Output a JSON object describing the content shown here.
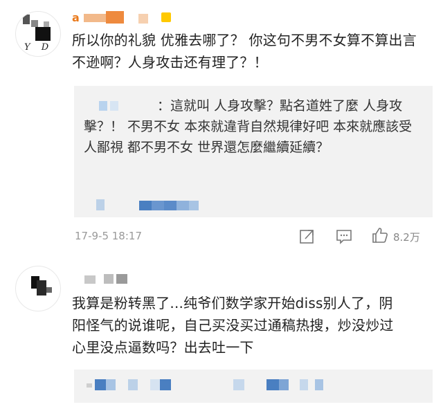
{
  "comments": [
    {
      "username": "a",
      "text": "所以你的礼貌 优雅去哪了？ 你这句不男不女算不算出言不逊啊？人身攻击还有理了？！",
      "quote": {
        "text": "：這就叫 人身攻擊？點名道姓了麼 人身攻擊？！ 不男不女 本來就違背自然規律好吧 本來就應該受人鄙視 都不男不女 世界還怎麼繼續延續？"
      },
      "timestamp": "17-9-5 18:17",
      "likes": "8.2万",
      "avatar_text": "Y D"
    },
    {
      "username": "",
      "text": "我算是粉转黑了...纯爷们数学家开始diss别人了，阴阳怪气的说谁呢，自己买没买过通稿热搜，炒没炒过心里没点逼数吗？出去吐一下"
    }
  ],
  "icons": [
    "forward-icon",
    "comment-icon",
    "like-icon"
  ],
  "colors": {
    "username": "#ea7a1c",
    "quote_bg": "#f2f2f2",
    "meta": "#999999",
    "blur_blue": "#4a7fc1"
  }
}
